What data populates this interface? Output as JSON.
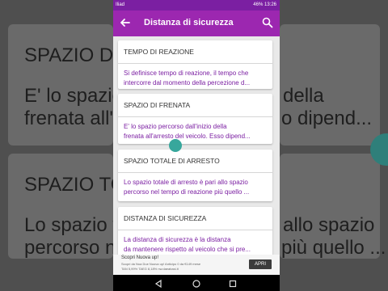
{
  "background": {
    "lines": [
      "SPAZIO DI F",
      "E' lo spazio",
      "della",
      "frenata all'a",
      "o dipend...",
      "SPAZIO TOTA",
      "Lo spazio to",
      "allo spazio",
      "percorso nel",
      "più quello ..."
    ]
  },
  "status_bar": {
    "carrier": "Iliad",
    "battery": "46%",
    "time": "13:26"
  },
  "app_bar": {
    "title": "Distanza di sicurezza",
    "back_icon": "arrow-left-icon",
    "search_icon": "search-icon"
  },
  "cards": [
    {
      "heading": "TEMPO DI REAZIONE",
      "line1": "Si definisce tempo di reazione, il tempo che",
      "line2": "intercorre dal momento della percezione d..."
    },
    {
      "heading": "SPAZIO DI FRENATA",
      "line1": "E' lo spazio percorso dall'inizio della",
      "line2": "frenata all'arresto del veicolo. Esso dipend..."
    },
    {
      "heading": "SPAZIO TOTALE DI ARRESTO",
      "line1": "Lo spazio totale di arresto è pari allo spazio",
      "line2": "percorso nel tempo di reazione più quello ..."
    },
    {
      "heading": "DISTANZA DI SICUREZZA",
      "line1": "La distanza di sicurezza è la distanza",
      "line2": "da mantenere rispetto al veicolo che si pre..."
    }
  ],
  "ad": {
    "title": "Scopri Nuova up!",
    "line1": "Scopri da Noa Due Nuova up! Anticipo 0 da €149 mese",
    "line2": "TAN 5,99% TAEG 8,18% nw.daeabasi.it",
    "button": "APRI"
  },
  "colors": {
    "status_bar": "#7b1fa2",
    "app_bar": "#9c27b0",
    "description_text": "#7b1fa2",
    "fab": "#37a79c"
  }
}
